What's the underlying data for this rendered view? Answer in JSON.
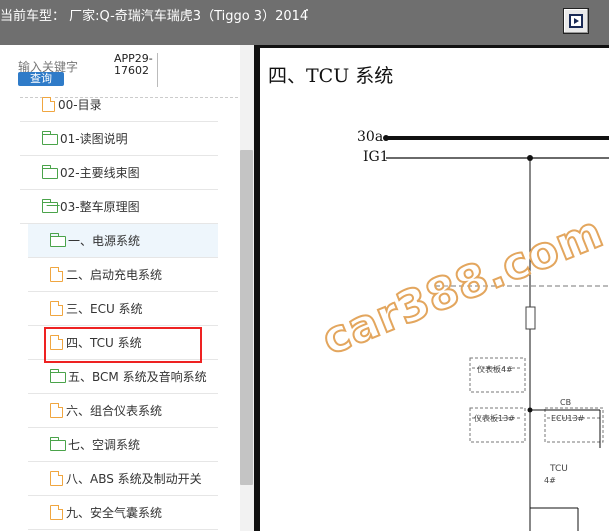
{
  "header": {
    "title": "当前车型：  厂家:Q-奇瑞汽车瑞虎3（Tiggo 3）2014"
  },
  "search": {
    "label": "输入关键字",
    "value": "APP29-17602",
    "button_label": "查询"
  },
  "tree": [
    {
      "label": "00-目录",
      "icon": "document-icon"
    },
    {
      "label": "01-读图说明",
      "icon": "folder-icon"
    },
    {
      "label": "02-主要线束图",
      "icon": "folder-icon"
    },
    {
      "label": "03-整车原理图",
      "icon": "folder-open-icon"
    },
    {
      "label": "一、电源系统",
      "icon": "folder-icon"
    },
    {
      "label": "二、启动充电系统",
      "icon": "document-icon"
    },
    {
      "label": "三、ECU 系统",
      "icon": "document-icon"
    },
    {
      "label": "四、TCU 系统",
      "icon": "document-icon"
    },
    {
      "label": "五、BCM 系统及音响系统",
      "icon": "folder-icon"
    },
    {
      "label": "六、组合仪表系统",
      "icon": "document-icon"
    },
    {
      "label": "七、空调系统",
      "icon": "folder-icon"
    },
    {
      "label": "八、ABS 系统及制动开关",
      "icon": "document-icon"
    },
    {
      "label": "九、安全气囊系统",
      "icon": "document-icon"
    }
  ],
  "diagram": {
    "title": "四、TCU 系统",
    "rail1": "30a",
    "rail2": "IG1",
    "watermark": "car388.com",
    "labels": {
      "box1": "仪表板4#",
      "box2": "仪表板13#",
      "box3": "ECU13#",
      "cb": "CB",
      "tcu": "TCU",
      "tcu_pin": "4#"
    }
  }
}
